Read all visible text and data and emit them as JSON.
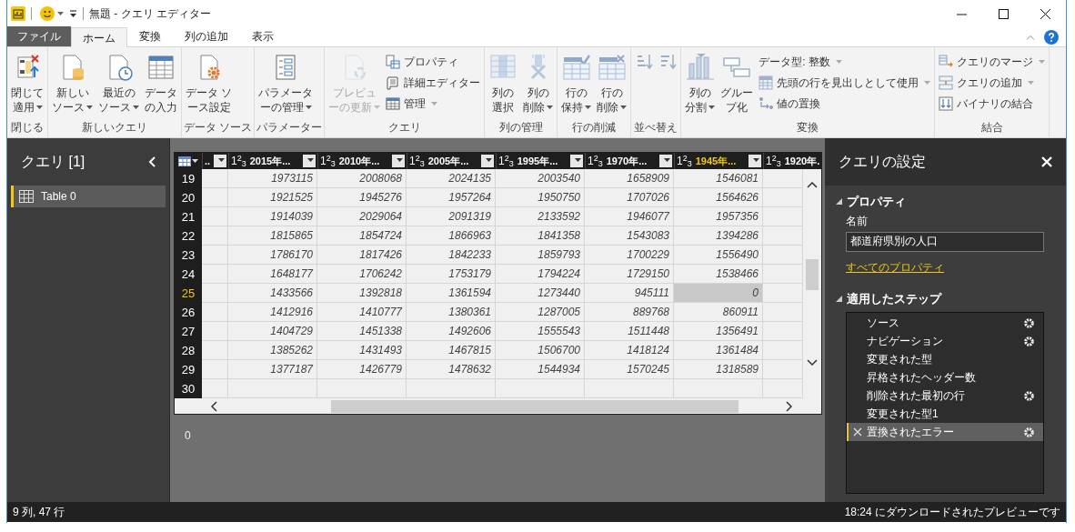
{
  "window": {
    "title": "無題 - クエリ エディター"
  },
  "ribbon_tabs": [
    {
      "label": "ファイル",
      "kind": "file",
      "selected": false
    },
    {
      "label": "ホーム",
      "kind": "tab",
      "selected": true
    },
    {
      "label": "変換",
      "kind": "tab",
      "selected": false
    },
    {
      "label": "列の追加",
      "kind": "tab",
      "selected": false
    },
    {
      "label": "表示",
      "kind": "tab",
      "selected": false
    }
  ],
  "ribbon_groups": [
    {
      "label": "閉じる",
      "items": [
        {
          "kind": "large",
          "label": "閉じて適用",
          "dropdown": true,
          "disabled": false
        }
      ]
    },
    {
      "label": "新しいクエリ",
      "items": [
        {
          "kind": "large",
          "label": "新しいソース",
          "dropdown": true,
          "disabled": false
        },
        {
          "kind": "large",
          "label": "最近のソース",
          "dropdown": true,
          "disabled": false
        },
        {
          "kind": "large",
          "label": "データの入力",
          "dropdown": false,
          "disabled": false
        }
      ]
    },
    {
      "label": "データ ソース",
      "items": [
        {
          "kind": "large",
          "label": "データ ソース設定",
          "dropdown": false,
          "disabled": false
        }
      ]
    },
    {
      "label": "パラメーター",
      "items": [
        {
          "kind": "large",
          "label": "パラメーターの管理",
          "dropdown": true,
          "disabled": false
        }
      ]
    },
    {
      "label": "クエリ",
      "items": [
        {
          "kind": "large",
          "label": "プレビューの更新",
          "dropdown": true,
          "disabled": true
        },
        {
          "kind": "small",
          "label": "プロパティ",
          "dropdown": false,
          "disabled": false
        },
        {
          "kind": "small",
          "label": "詳細エディター",
          "dropdown": false,
          "disabled": false
        },
        {
          "kind": "small",
          "label": "管理",
          "dropdown": true,
          "disabled": false
        }
      ]
    },
    {
      "label": "列の管理",
      "items": [
        {
          "kind": "large",
          "label": "列の選択",
          "dropdown": false,
          "disabled": false
        },
        {
          "kind": "large",
          "label": "列の削除",
          "dropdown": true,
          "disabled": false
        }
      ]
    },
    {
      "label": "行の削減",
      "items": [
        {
          "kind": "large",
          "label": "行の保持",
          "dropdown": true,
          "disabled": false
        },
        {
          "kind": "large",
          "label": "行の削除",
          "dropdown": true,
          "disabled": false
        }
      ]
    },
    {
      "label": "並べ替え",
      "items": [
        {
          "kind": "icon",
          "dropdown": false,
          "disabled": false
        },
        {
          "kind": "icon",
          "dropdown": false,
          "disabled": false
        }
      ]
    },
    {
      "label": "変換",
      "items": [
        {
          "kind": "large",
          "label": "列の分割",
          "dropdown": true,
          "disabled": false
        },
        {
          "kind": "large",
          "label": "グループ化",
          "dropdown": false,
          "disabled": false
        },
        {
          "kind": "text",
          "label": "データ型: 整数",
          "dropdown": true,
          "disabled": false
        },
        {
          "kind": "small",
          "label": "先頭の行を見出しとして使用",
          "dropdown": true,
          "disabled": false
        },
        {
          "kind": "small",
          "label": "値の置換",
          "dropdown": false,
          "disabled": false
        }
      ]
    },
    {
      "label": "結合",
      "items": [
        {
          "kind": "small",
          "label": "クエリのマージ",
          "dropdown": true,
          "disabled": false
        },
        {
          "kind": "small",
          "label": "クエリの追加",
          "dropdown": true,
          "disabled": false
        },
        {
          "kind": "small",
          "label": "バイナリの結合",
          "dropdown": false,
          "disabled": false
        }
      ]
    }
  ],
  "queries": {
    "title": "クエリ [1]",
    "items": [
      {
        "label": "Table 0",
        "selected": true
      }
    ]
  },
  "grid": {
    "columns": [
      {
        "label": "..",
        "filter_button": true,
        "selected": false
      },
      {
        "type": "1$^{2}$$_{3}$",
        "label": "2015年...",
        "filter_button": true,
        "selected": false
      },
      {
        "type": "1$^{2}$$_{3}$",
        "label": "2010年...",
        "filter_button": true,
        "selected": false
      },
      {
        "type": "1$^{2}$$_{3}$",
        "label": "2005年...",
        "filter_button": true,
        "selected": false
      },
      {
        "type": "1$^{2}$$_{3}$",
        "label": "1995年...",
        "filter_button": true,
        "selected": false
      },
      {
        "type": "1$^{2}$$_{3}$",
        "label": "1970年...",
        "filter_button": true,
        "selected": false
      },
      {
        "type": "1$^{2}$$_{3}$",
        "label": "1945年...",
        "filter_button": true,
        "selected": true
      },
      {
        "type": "1$^{2}$$_{3}$",
        "label": "1920年.",
        "filter_button": false,
        "selected": false
      }
    ],
    "rows": [
      {
        "number": "19",
        "selected": false,
        "cells": [
          "1973115",
          "2008068",
          "2024135",
          "2003540",
          "1658909",
          "1546081"
        ]
      },
      {
        "number": "20",
        "selected": false,
        "cells": [
          "1921525",
          "1945276",
          "1957264",
          "1950750",
          "1707026",
          "1564626"
        ]
      },
      {
        "number": "21",
        "selected": false,
        "cells": [
          "1914039",
          "2029064",
          "2091319",
          "2133592",
          "1946077",
          "1957356"
        ]
      },
      {
        "number": "22",
        "selected": false,
        "cells": [
          "1815865",
          "1854724",
          "1866963",
          "1841358",
          "1543083",
          "1394286"
        ]
      },
      {
        "number": "23",
        "selected": false,
        "cells": [
          "1786170",
          "1817426",
          "1842233",
          "1859793",
          "1700229",
          "1556490"
        ]
      },
      {
        "number": "24",
        "selected": false,
        "cells": [
          "1648177",
          "1706242",
          "1753179",
          "1794224",
          "1729150",
          "1538466"
        ]
      },
      {
        "number": "25",
        "selected": true,
        "cells": [
          "1433566",
          "1392818",
          "1361594",
          "1273440",
          "945111",
          "0"
        ]
      },
      {
        "number": "26",
        "selected": false,
        "cells": [
          "1412916",
          "1410777",
          "1380361",
          "1287005",
          "889768",
          "860911"
        ]
      },
      {
        "number": "27",
        "selected": false,
        "cells": [
          "1404729",
          "1451338",
          "1492606",
          "1555543",
          "1511448",
          "1356491"
        ]
      },
      {
        "number": "28",
        "selected": false,
        "cells": [
          "1385262",
          "1431493",
          "1467815",
          "1506700",
          "1418124",
          "1361484"
        ]
      },
      {
        "number": "29",
        "selected": false,
        "cells": [
          "1377187",
          "1426779",
          "1478632",
          "1544934",
          "1570245",
          "1318589"
        ]
      },
      {
        "number": "30",
        "selected": false,
        "cells": []
      }
    ]
  },
  "preview_footer": "0",
  "query_settings": {
    "title": "クエリの設定",
    "properties": {
      "heading": "プロパティ",
      "name_label": "名前",
      "name_value": "都道府県別の人口",
      "link": "すべてのプロパティ"
    },
    "steps": {
      "heading": "適用したステップ",
      "items": [
        {
          "label": "ソース",
          "settings": true,
          "selected": false
        },
        {
          "label": "ナビゲーション",
          "settings": true,
          "selected": false
        },
        {
          "label": "変更された型",
          "settings": false,
          "selected": false
        },
        {
          "label": "昇格されたヘッダー数",
          "settings": false,
          "selected": false
        },
        {
          "label": "削除された最初の行",
          "settings": true,
          "selected": false
        },
        {
          "label": "変更された型1",
          "settings": false,
          "selected": false
        },
        {
          "label": "置換されたエラー",
          "settings": true,
          "selected": true
        }
      ]
    }
  },
  "status_bar": {
    "left": "9 列, 47 行",
    "right": "18:24 にダウンロードされたプレビューです"
  }
}
